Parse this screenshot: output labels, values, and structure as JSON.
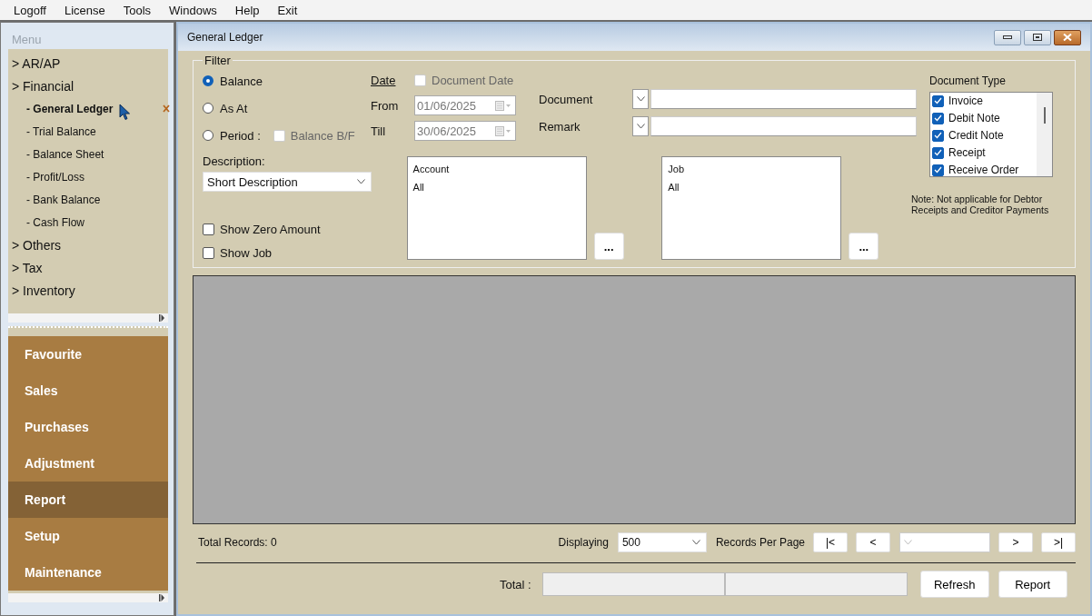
{
  "menubar": [
    "Logoff",
    "License",
    "Tools",
    "Windows",
    "Help",
    "Exit"
  ],
  "sidebar": {
    "title": "Menu",
    "tree": [
      {
        "marker": ">",
        "label": "AR/AP",
        "selected": false
      },
      {
        "marker": ">",
        "label": "Financial",
        "selected": false,
        "children": [
          {
            "marker": "-",
            "label": "General Ledger",
            "selected": true
          },
          {
            "marker": "-",
            "label": "Trial Balance",
            "selected": false
          },
          {
            "marker": "-",
            "label": "Balance Sheet",
            "selected": false
          },
          {
            "marker": "-",
            "label": "Profit/Loss",
            "selected": false
          },
          {
            "marker": "-",
            "label": "Bank Balance",
            "selected": false
          },
          {
            "marker": "-",
            "label": "Cash Flow",
            "selected": false
          }
        ]
      },
      {
        "marker": ">",
        "label": "Others",
        "selected": false
      },
      {
        "marker": ">",
        "label": "Tax",
        "selected": false
      },
      {
        "marker": ">",
        "label": "Inventory",
        "selected": false
      }
    ],
    "modules": [
      {
        "label": "Favourite",
        "selected": false
      },
      {
        "label": "Sales",
        "selected": false
      },
      {
        "label": "Purchases",
        "selected": false
      },
      {
        "label": "Adjustment",
        "selected": false
      },
      {
        "label": "Report",
        "selected": true
      },
      {
        "label": "Setup",
        "selected": false
      },
      {
        "label": "Maintenance",
        "selected": false
      }
    ]
  },
  "window": {
    "title": "General Ledger",
    "filter": {
      "legend": "Filter",
      "modes": [
        {
          "label": "Balance",
          "selected": true
        },
        {
          "label": "As At",
          "selected": false
        },
        {
          "label": "Period :",
          "selected": false
        }
      ],
      "balance_bf": {
        "label": "Balance B/F",
        "checked": false,
        "disabled": true
      },
      "date": {
        "label": "Date",
        "document_date": {
          "label": "Document Date",
          "checked": false,
          "disabled": true
        },
        "from": {
          "label": "From",
          "value": "01/06/2025",
          "disabled": true
        },
        "till": {
          "label": "Till",
          "value": "30/06/2025",
          "disabled": true
        }
      },
      "document": {
        "label": "Document"
      },
      "remark": {
        "label": "Remark"
      },
      "description": {
        "label": "Description:",
        "value": "Short Description"
      },
      "options": [
        {
          "label": "Show Zero Amount",
          "checked": false
        },
        {
          "label": "Show Job",
          "checked": false
        }
      ],
      "account_list": {
        "header": "Account",
        "items": [
          "All"
        ],
        "button": "..."
      },
      "job_list": {
        "header": "Job",
        "items": [
          "All"
        ],
        "button": "..."
      },
      "document_type": {
        "label": "Document Type",
        "items": [
          {
            "label": "Invoice",
            "checked": true
          },
          {
            "label": "Debit Note",
            "checked": true
          },
          {
            "label": "Credit Note",
            "checked": true
          },
          {
            "label": "Receipt",
            "checked": true
          },
          {
            "label": "Receive Order",
            "checked": true
          }
        ],
        "note": "Note: Not applicable for Debtor Receipts and Creditor Payments"
      }
    },
    "footer": {
      "total_records": "Total Records: 0",
      "displaying": "Displaying",
      "per_page": "500",
      "records_per_page": "Records Per Page",
      "nav_before": [
        "|<",
        "<"
      ],
      "nav_after": [
        ">",
        ">|"
      ],
      "total_label": "Total :",
      "buttons": [
        "Refresh",
        "Report"
      ]
    }
  }
}
